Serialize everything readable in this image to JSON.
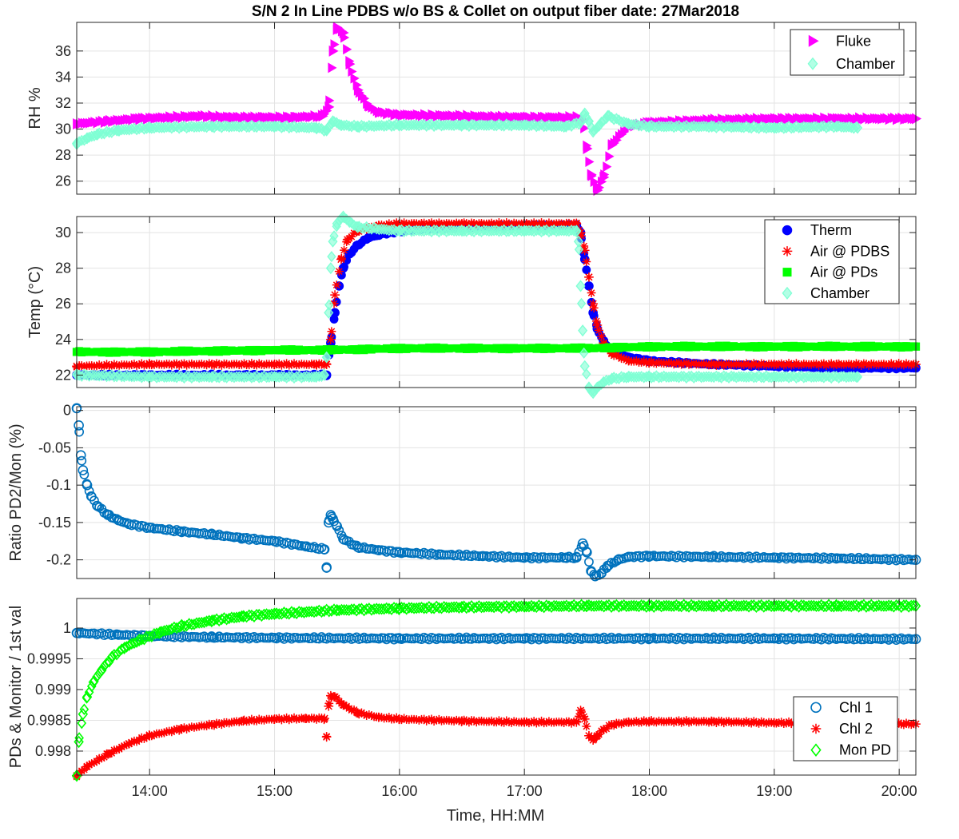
{
  "figure": {
    "title": "S/N 2 In Line PDBS w/o BS & Collet on output fiber date: 27Mar2018",
    "xlabel": "Time, HH:MM",
    "x_ticks": [
      "14:00",
      "15:00",
      "16:00",
      "17:00",
      "18:00",
      "19:00",
      "20:00"
    ]
  },
  "chart_data": [
    {
      "type": "scatter",
      "ylabel": "RH %",
      "xlim": [
        "13:25",
        "20:08"
      ],
      "ylim": [
        25,
        38.2
      ],
      "y_ticks": [
        "26",
        "28",
        "30",
        "32",
        "34",
        "36"
      ],
      "grid": true,
      "legend": "top-right",
      "series": [
        {
          "name": "Fluke",
          "color": "#ff00ff",
          "marker": "triangle-right",
          "x": [
            "13:25",
            "13:40",
            "13:55",
            "14:10",
            "14:25",
            "14:40",
            "14:55",
            "15:10",
            "15:23",
            "15:26",
            "15:28",
            "15:30",
            "15:33",
            "15:36",
            "15:40",
            "15:45",
            "15:50",
            "16:00",
            "16:30",
            "17:00",
            "17:25",
            "17:28",
            "17:30",
            "17:32",
            "17:35",
            "17:38",
            "17:42",
            "17:50",
            "18:00",
            "18:30",
            "19:00",
            "19:30",
            "20:08"
          ],
          "y": [
            30.4,
            30.6,
            30.8,
            30.9,
            31.0,
            30.9,
            30.9,
            30.9,
            31.0,
            31.7,
            36.0,
            37.8,
            37.4,
            35.0,
            33.0,
            31.8,
            31.3,
            31.1,
            31.0,
            30.9,
            30.9,
            30.7,
            28.5,
            26.5,
            25.3,
            26.3,
            28.8,
            30.2,
            30.5,
            30.7,
            30.8,
            30.8,
            30.8
          ]
        },
        {
          "name": "Chamber",
          "color": "#7fffd4",
          "marker": "diamond",
          "x": [
            "13:25",
            "13:30",
            "13:35",
            "13:45",
            "14:00",
            "14:30",
            "15:00",
            "15:20",
            "15:25",
            "15:28",
            "15:32",
            "15:40",
            "16:00",
            "16:30",
            "17:00",
            "17:20",
            "17:27",
            "17:29",
            "17:31",
            "17:33",
            "17:36",
            "17:40",
            "17:50",
            "18:00",
            "18:30",
            "19:00",
            "19:30",
            "19:40"
          ],
          "y": [
            28.9,
            29.3,
            29.6,
            29.9,
            30.1,
            30.2,
            30.2,
            30.1,
            29.9,
            30.6,
            30.3,
            30.2,
            30.3,
            30.3,
            30.3,
            30.2,
            30.5,
            31.2,
            30.6,
            29.8,
            30.3,
            31.0,
            30.4,
            30.2,
            30.2,
            30.1,
            30.2,
            30.1
          ]
        }
      ]
    },
    {
      "type": "scatter",
      "ylabel": "Temp (°C)",
      "xlim": [
        "13:25",
        "20:08"
      ],
      "ylim": [
        21.3,
        30.9
      ],
      "y_ticks": [
        "22",
        "24",
        "26",
        "28",
        "30"
      ],
      "grid": true,
      "legend": "top-right",
      "series": [
        {
          "name": "Therm",
          "color": "#0000ff",
          "marker": "circle",
          "x": [
            "13:25",
            "14:00",
            "14:30",
            "15:00",
            "15:20",
            "15:25",
            "15:27",
            "15:29",
            "15:31",
            "15:33",
            "15:36",
            "15:40",
            "15:45",
            "15:55",
            "16:10",
            "16:30",
            "17:00",
            "17:25",
            "17:27",
            "17:29",
            "17:31",
            "17:33",
            "17:35",
            "17:38",
            "17:42",
            "17:50",
            "18:00",
            "18:30",
            "19:00",
            "19:30",
            "20:08"
          ],
          "y": [
            22.0,
            22.0,
            22.0,
            22.0,
            22.0,
            22.0,
            23.8,
            25.5,
            27.0,
            28.0,
            28.8,
            29.3,
            29.7,
            30.0,
            30.2,
            30.3,
            30.4,
            30.4,
            30.0,
            28.5,
            27.0,
            25.5,
            24.6,
            23.9,
            23.4,
            23.0,
            22.8,
            22.6,
            22.5,
            22.4,
            22.4
          ]
        },
        {
          "name": "Air @ PDBS",
          "color": "#ff0000",
          "marker": "star",
          "x": [
            "13:25",
            "14:00",
            "14:30",
            "15:00",
            "15:20",
            "15:25",
            "15:27",
            "15:29",
            "15:32",
            "15:35",
            "15:40",
            "15:50",
            "16:00",
            "16:30",
            "17:00",
            "17:25",
            "17:27",
            "17:29",
            "17:31",
            "17:33",
            "17:35",
            "17:38",
            "17:42",
            "17:50",
            "18:00",
            "18:30",
            "19:00",
            "19:30",
            "20:08"
          ],
          "y": [
            22.5,
            22.6,
            22.6,
            22.6,
            22.6,
            22.6,
            24.0,
            26.5,
            28.5,
            29.6,
            30.1,
            30.4,
            30.5,
            30.5,
            30.5,
            30.5,
            30.0,
            29.0,
            27.5,
            26.0,
            24.8,
            23.8,
            23.2,
            22.8,
            22.7,
            22.6,
            22.6,
            22.6,
            22.6
          ]
        },
        {
          "name": "Air @ PDs",
          "color": "#00ff00",
          "marker": "square",
          "x": [
            "13:25",
            "14:00",
            "15:00",
            "15:25",
            "16:00",
            "17:00",
            "17:30",
            "18:00",
            "19:00",
            "20:08"
          ],
          "y": [
            23.3,
            23.3,
            23.4,
            23.4,
            23.5,
            23.5,
            23.5,
            23.6,
            23.6,
            23.6
          ]
        },
        {
          "name": "Chamber",
          "color": "#7fffd4",
          "marker": "diamond",
          "x": [
            "13:25",
            "14:00",
            "14:30",
            "15:00",
            "15:20",
            "15:24",
            "15:25",
            "15:26",
            "15:27",
            "15:28",
            "15:30",
            "15:33",
            "15:36",
            "15:40",
            "16:00",
            "16:30",
            "17:00",
            "17:25",
            "17:26",
            "17:27",
            "17:28",
            "17:29",
            "17:31",
            "17:33",
            "17:35",
            "17:38",
            "17:42",
            "17:50",
            "18:00",
            "19:00",
            "19:40"
          ],
          "y": [
            22.0,
            21.9,
            21.9,
            21.9,
            21.9,
            22.0,
            23.0,
            25.5,
            28.0,
            29.5,
            30.5,
            30.9,
            30.6,
            30.3,
            30.1,
            30.1,
            30.1,
            30.1,
            29.5,
            27.0,
            24.5,
            22.5,
            21.3,
            21.0,
            21.3,
            21.6,
            21.8,
            21.9,
            21.9,
            21.9,
            21.9
          ]
        }
      ]
    },
    {
      "type": "scatter",
      "ylabel": "Ratio PD2/Mon (%)",
      "xlim": [
        "13:25",
        "20:08"
      ],
      "ylim": [
        -0.225,
        0.005
      ],
      "y_ticks": [
        "0",
        "-0.05",
        "-0.1",
        "-0.15",
        "-0.2"
      ],
      "grid": true,
      "series": [
        {
          "name": "",
          "color": "#0072bd",
          "marker": "circle-open",
          "x": [
            "13:25",
            "13:26",
            "13:27",
            "13:28",
            "13:30",
            "13:32",
            "13:35",
            "13:40",
            "13:45",
            "13:50",
            "14:00",
            "14:15",
            "14:30",
            "14:45",
            "15:00",
            "15:15",
            "15:24",
            "15:25",
            "15:26",
            "15:27",
            "15:28",
            "15:30",
            "15:33",
            "15:40",
            "15:50",
            "16:00",
            "16:20",
            "16:40",
            "17:00",
            "17:20",
            "17:25",
            "17:28",
            "17:30",
            "17:32",
            "17:34",
            "17:37",
            "17:40",
            "17:45",
            "17:50",
            "18:00",
            "18:30",
            "19:00",
            "19:30",
            "20:08"
          ],
          "y": [
            0.003,
            -0.02,
            -0.06,
            -0.08,
            -0.1,
            -0.115,
            -0.128,
            -0.14,
            -0.147,
            -0.152,
            -0.157,
            -0.162,
            -0.166,
            -0.171,
            -0.175,
            -0.182,
            -0.186,
            -0.21,
            -0.15,
            -0.14,
            -0.145,
            -0.155,
            -0.172,
            -0.183,
            -0.187,
            -0.19,
            -0.193,
            -0.195,
            -0.197,
            -0.197,
            -0.197,
            -0.178,
            -0.19,
            -0.215,
            -0.222,
            -0.218,
            -0.208,
            -0.2,
            -0.196,
            -0.195,
            -0.196,
            -0.197,
            -0.198,
            -0.2
          ]
        }
      ]
    },
    {
      "type": "scatter",
      "ylabel": "PDs & Monitor / 1st val",
      "xlim": [
        "13:25",
        "20:08"
      ],
      "ylim": [
        0.99761,
        1.00048
      ],
      "y_ticks": [
        "0.998",
        "0.9985",
        "0.999",
        "0.9995",
        "1"
      ],
      "grid": true,
      "legend": "bottom-right",
      "series": [
        {
          "name": "Chl 1",
          "color": "#0072bd",
          "marker": "circle-open",
          "x": [
            "13:25",
            "13:45",
            "14:00",
            "14:30",
            "15:00",
            "16:00",
            "17:00",
            "18:00",
            "19:00",
            "20:08"
          ],
          "y": [
            0.99992,
            0.99989,
            0.99987,
            0.99985,
            0.99984,
            0.99983,
            0.99983,
            0.99983,
            0.99983,
            0.99982
          ]
        },
        {
          "name": "Chl 2",
          "color": "#ff0000",
          "marker": "star",
          "x": [
            "13:25",
            "13:30",
            "13:40",
            "13:50",
            "14:00",
            "14:15",
            "14:30",
            "14:45",
            "15:00",
            "15:15",
            "15:24",
            "15:25",
            "15:26",
            "15:27",
            "15:29",
            "15:33",
            "15:40",
            "15:50",
            "16:00",
            "16:30",
            "17:00",
            "17:25",
            "17:27",
            "17:29",
            "17:31",
            "17:33",
            "17:35",
            "17:38",
            "17:42",
            "17:50",
            "18:00",
            "18:30",
            "19:00",
            "19:30",
            "20:08"
          ],
          "y": [
            0.9976,
            0.99775,
            0.99795,
            0.99812,
            0.99825,
            0.99836,
            0.99843,
            0.99849,
            0.99852,
            0.99853,
            0.99853,
            0.99823,
            0.99873,
            0.9989,
            0.99888,
            0.99875,
            0.99862,
            0.99855,
            0.99852,
            0.99849,
            0.99847,
            0.99847,
            0.99866,
            0.99852,
            0.99825,
            0.99818,
            0.99825,
            0.99835,
            0.99843,
            0.99847,
            0.99848,
            0.99848,
            0.99846,
            0.99845,
            0.99844
          ]
        },
        {
          "name": "Mon PD",
          "color": "#00ff00",
          "marker": "diamond-open",
          "x": [
            "13:25",
            "13:26",
            "13:28",
            "13:30",
            "13:33",
            "13:37",
            "13:42",
            "13:48",
            "13:55",
            "14:05",
            "14:15",
            "14:30",
            "14:45",
            "15:00",
            "15:30",
            "16:00",
            "16:30",
            "17:00",
            "17:30",
            "18:00",
            "18:30",
            "19:00",
            "19:30",
            "20:08"
          ],
          "y": [
            0.9976,
            0.99815,
            0.9986,
            0.99888,
            0.99912,
            0.99932,
            0.99953,
            0.99968,
            0.9998,
            0.99993,
            1.00003,
            1.00012,
            1.00019,
            1.00023,
            1.00029,
            1.00032,
            1.00034,
            1.00035,
            1.00036,
            1.00036,
            1.00036,
            1.00036,
            1.00036,
            1.00036
          ]
        }
      ]
    }
  ]
}
